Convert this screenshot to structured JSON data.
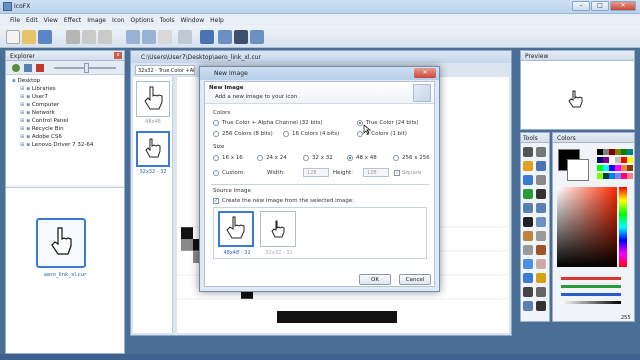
{
  "app": {
    "title": "IcoFX"
  },
  "menu": [
    "File",
    "Edit",
    "View",
    "Effect",
    "Image",
    "Icon",
    "Options",
    "Tools",
    "Window",
    "Help"
  ],
  "explorer": {
    "title": "Explorer",
    "tree": [
      "Desktop",
      "Libraries",
      "User7",
      "Computer",
      "Network",
      "Control Panel",
      "Recycle Bin",
      "Adobe CS6",
      "Lenovo Driver 7 32-64"
    ],
    "file_label": "aero_link_xl.cur"
  },
  "document": {
    "path": "C:\\Users\\User7\\Desktop\\aero_link_xl.cur",
    "tab": "32x32 - True Color +Alph",
    "thumbs": [
      "48x48",
      "32x32 - 32"
    ]
  },
  "dialog": {
    "title": "New Image",
    "header_title": "New Image",
    "header_sub": "Add a new image to your icon",
    "colors_label": "Colors",
    "colors": [
      "True Color + Alpha Channel (32 bits)",
      "True Color (24 bits)",
      "256 Colors (8 bits)",
      "16 Colors (4 bits)",
      "2 Colors (1 bit)"
    ],
    "size_label": "Size",
    "sizes": [
      "16 x 16",
      "24 x 24",
      "32 x 32",
      "48 x 48",
      "256 x 256"
    ],
    "custom_label": "Custom:",
    "width_label": "Width:",
    "width_value": "128",
    "height_label": "Height:",
    "height_value": "128",
    "square_label": "Square",
    "source_label": "Source Image",
    "source_check": "Create the new image from the selected image:",
    "source_thumbs": [
      "48x48 - 32",
      "32x32 - 32"
    ],
    "ok": "OK",
    "cancel": "Cancel"
  },
  "preview": {
    "title": "Preview"
  },
  "tools": {
    "title": "Tools"
  },
  "colors_panel": {
    "title": "Colors",
    "value": "255"
  },
  "accent": "#3b7bd1"
}
